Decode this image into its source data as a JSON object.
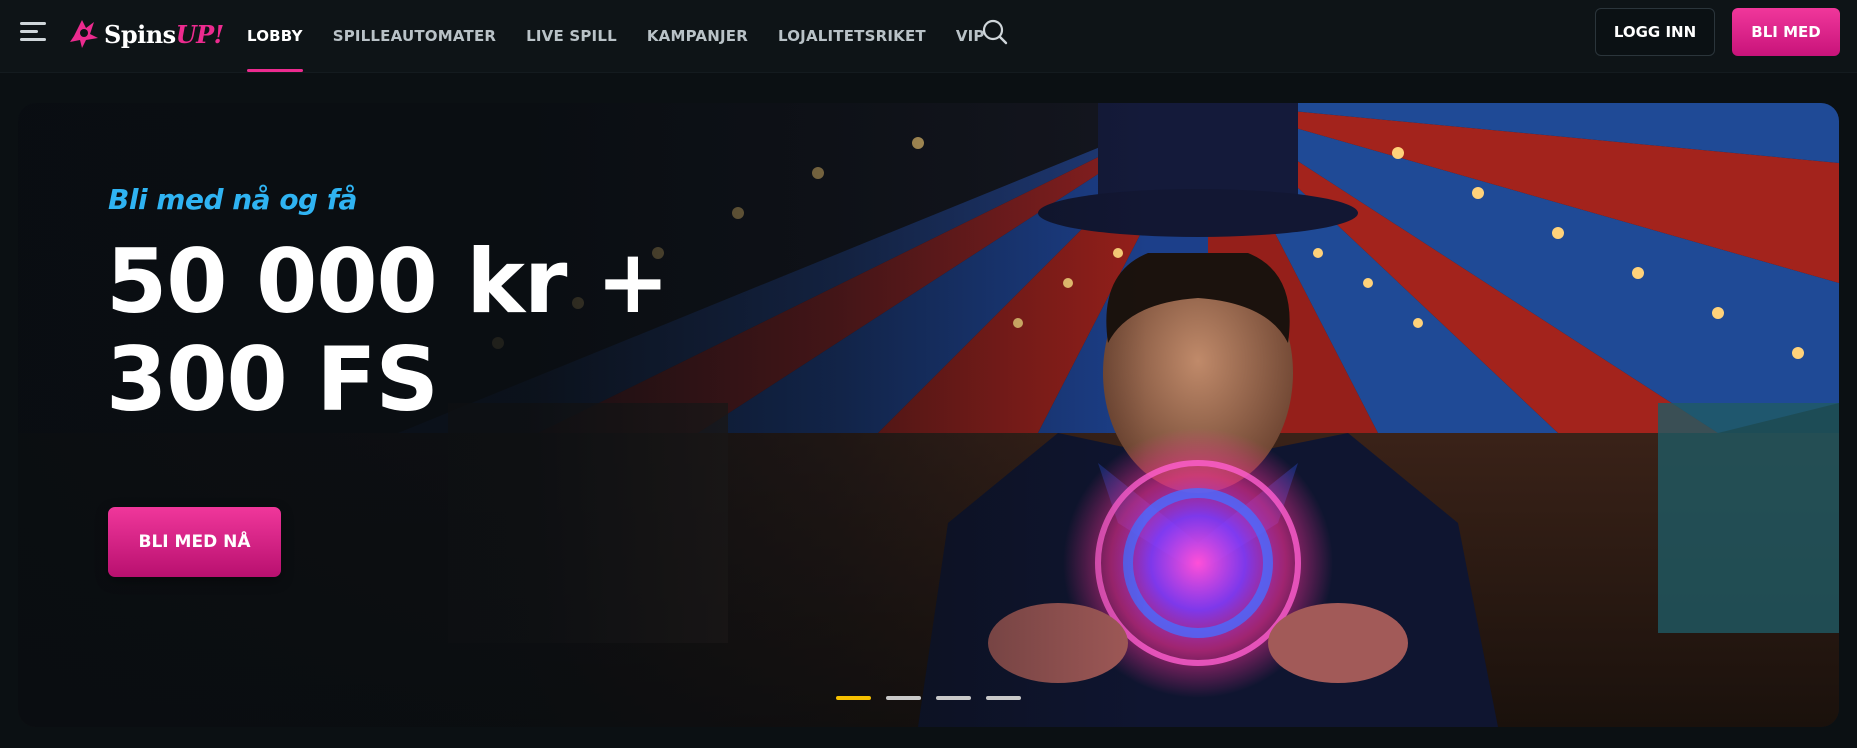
{
  "header": {
    "logo": {
      "part_a": "Spins",
      "part_b": "UP!"
    },
    "nav": [
      {
        "label": "LOBBY",
        "active": true
      },
      {
        "label": "SPILLEAUTOMATER",
        "active": false
      },
      {
        "label": "LIVE SPILL",
        "active": false
      },
      {
        "label": "KAMPANJER",
        "active": false
      },
      {
        "label": "LOJALITETSRIKET",
        "active": false
      },
      {
        "label": "VIP",
        "active": false
      }
    ],
    "login_label": "LOGG INN",
    "join_label": "BLI MED"
  },
  "hero": {
    "subtitle": "Bli med nå og få",
    "title_line1": "50 000 kr +",
    "title_line2": "300 FS",
    "cta_label": "BLI MED NÅ",
    "slides": [
      true,
      false,
      false,
      false
    ]
  },
  "colors": {
    "accent_pink": "#ec2b8f",
    "subtitle_blue": "#2fb3f2",
    "active_dot": "#f6c000"
  },
  "icons": [
    "menu-icon",
    "logo-icon",
    "search-icon"
  ]
}
